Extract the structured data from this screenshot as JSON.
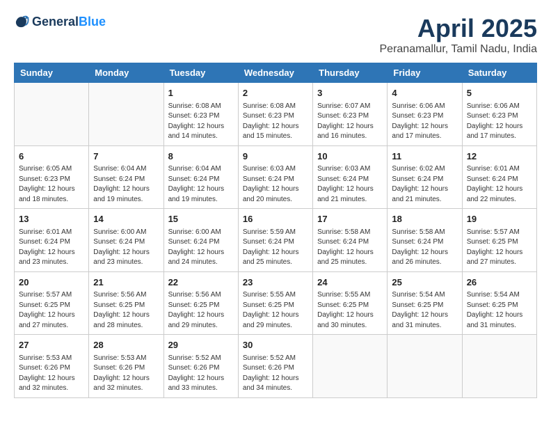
{
  "header": {
    "logo_general": "General",
    "logo_blue": "Blue",
    "title": "April 2025",
    "subtitle": "Peranamallur, Tamil Nadu, India"
  },
  "calendar": {
    "weekdays": [
      "Sunday",
      "Monday",
      "Tuesday",
      "Wednesday",
      "Thursday",
      "Friday",
      "Saturday"
    ],
    "weeks": [
      [
        {
          "day": "",
          "info": ""
        },
        {
          "day": "",
          "info": ""
        },
        {
          "day": "1",
          "info": "Sunrise: 6:08 AM\nSunset: 6:23 PM\nDaylight: 12 hours and 14 minutes."
        },
        {
          "day": "2",
          "info": "Sunrise: 6:08 AM\nSunset: 6:23 PM\nDaylight: 12 hours and 15 minutes."
        },
        {
          "day": "3",
          "info": "Sunrise: 6:07 AM\nSunset: 6:23 PM\nDaylight: 12 hours and 16 minutes."
        },
        {
          "day": "4",
          "info": "Sunrise: 6:06 AM\nSunset: 6:23 PM\nDaylight: 12 hours and 17 minutes."
        },
        {
          "day": "5",
          "info": "Sunrise: 6:06 AM\nSunset: 6:23 PM\nDaylight: 12 hours and 17 minutes."
        }
      ],
      [
        {
          "day": "6",
          "info": "Sunrise: 6:05 AM\nSunset: 6:23 PM\nDaylight: 12 hours and 18 minutes."
        },
        {
          "day": "7",
          "info": "Sunrise: 6:04 AM\nSunset: 6:24 PM\nDaylight: 12 hours and 19 minutes."
        },
        {
          "day": "8",
          "info": "Sunrise: 6:04 AM\nSunset: 6:24 PM\nDaylight: 12 hours and 19 minutes."
        },
        {
          "day": "9",
          "info": "Sunrise: 6:03 AM\nSunset: 6:24 PM\nDaylight: 12 hours and 20 minutes."
        },
        {
          "day": "10",
          "info": "Sunrise: 6:03 AM\nSunset: 6:24 PM\nDaylight: 12 hours and 21 minutes."
        },
        {
          "day": "11",
          "info": "Sunrise: 6:02 AM\nSunset: 6:24 PM\nDaylight: 12 hours and 21 minutes."
        },
        {
          "day": "12",
          "info": "Sunrise: 6:01 AM\nSunset: 6:24 PM\nDaylight: 12 hours and 22 minutes."
        }
      ],
      [
        {
          "day": "13",
          "info": "Sunrise: 6:01 AM\nSunset: 6:24 PM\nDaylight: 12 hours and 23 minutes."
        },
        {
          "day": "14",
          "info": "Sunrise: 6:00 AM\nSunset: 6:24 PM\nDaylight: 12 hours and 23 minutes."
        },
        {
          "day": "15",
          "info": "Sunrise: 6:00 AM\nSunset: 6:24 PM\nDaylight: 12 hours and 24 minutes."
        },
        {
          "day": "16",
          "info": "Sunrise: 5:59 AM\nSunset: 6:24 PM\nDaylight: 12 hours and 25 minutes."
        },
        {
          "day": "17",
          "info": "Sunrise: 5:58 AM\nSunset: 6:24 PM\nDaylight: 12 hours and 25 minutes."
        },
        {
          "day": "18",
          "info": "Sunrise: 5:58 AM\nSunset: 6:24 PM\nDaylight: 12 hours and 26 minutes."
        },
        {
          "day": "19",
          "info": "Sunrise: 5:57 AM\nSunset: 6:25 PM\nDaylight: 12 hours and 27 minutes."
        }
      ],
      [
        {
          "day": "20",
          "info": "Sunrise: 5:57 AM\nSunset: 6:25 PM\nDaylight: 12 hours and 27 minutes."
        },
        {
          "day": "21",
          "info": "Sunrise: 5:56 AM\nSunset: 6:25 PM\nDaylight: 12 hours and 28 minutes."
        },
        {
          "day": "22",
          "info": "Sunrise: 5:56 AM\nSunset: 6:25 PM\nDaylight: 12 hours and 29 minutes."
        },
        {
          "day": "23",
          "info": "Sunrise: 5:55 AM\nSunset: 6:25 PM\nDaylight: 12 hours and 29 minutes."
        },
        {
          "day": "24",
          "info": "Sunrise: 5:55 AM\nSunset: 6:25 PM\nDaylight: 12 hours and 30 minutes."
        },
        {
          "day": "25",
          "info": "Sunrise: 5:54 AM\nSunset: 6:25 PM\nDaylight: 12 hours and 31 minutes."
        },
        {
          "day": "26",
          "info": "Sunrise: 5:54 AM\nSunset: 6:25 PM\nDaylight: 12 hours and 31 minutes."
        }
      ],
      [
        {
          "day": "27",
          "info": "Sunrise: 5:53 AM\nSunset: 6:26 PM\nDaylight: 12 hours and 32 minutes."
        },
        {
          "day": "28",
          "info": "Sunrise: 5:53 AM\nSunset: 6:26 PM\nDaylight: 12 hours and 32 minutes."
        },
        {
          "day": "29",
          "info": "Sunrise: 5:52 AM\nSunset: 6:26 PM\nDaylight: 12 hours and 33 minutes."
        },
        {
          "day": "30",
          "info": "Sunrise: 5:52 AM\nSunset: 6:26 PM\nDaylight: 12 hours and 34 minutes."
        },
        {
          "day": "",
          "info": ""
        },
        {
          "day": "",
          "info": ""
        },
        {
          "day": "",
          "info": ""
        }
      ]
    ]
  }
}
